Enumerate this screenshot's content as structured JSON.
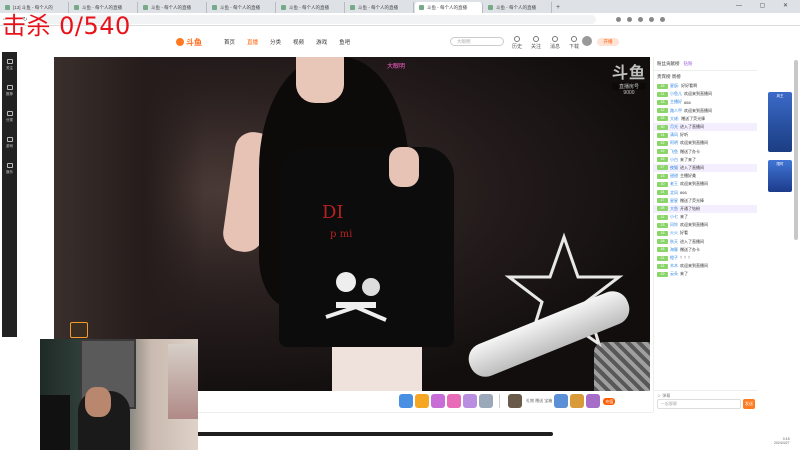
{
  "overlay": {
    "kill_counter": "击杀 0/540"
  },
  "browser": {
    "tabs": [
      {
        "label": "[13] 斗鱼 - 每个人的"
      },
      {
        "label": "斗鱼 - 每个人的直播"
      },
      {
        "label": "斗鱼 - 每个人的直播"
      },
      {
        "label": "斗鱼 - 每个人的直播"
      },
      {
        "label": "斗鱼 - 每个人的直播"
      },
      {
        "label": "斗鱼 - 每个人的直播"
      },
      {
        "label": "斗鱼 - 每个人的直播"
      },
      {
        "label": "斗鱼 - 每个人的直播"
      }
    ],
    "new_tab": "+",
    "window_controls": "— ▢ ✕"
  },
  "site": {
    "nav": [
      "首页",
      "直播",
      "分类",
      "视频",
      "游戏",
      "鱼吧"
    ],
    "search_placeholder": "大眼明",
    "header_icons": [
      "历史",
      "关注",
      "消息",
      "下载"
    ],
    "open_live": "开播"
  },
  "sidebar": {
    "items": [
      "关注",
      "推荐",
      "分类",
      "游戏",
      "娱乐"
    ]
  },
  "video": {
    "username_tag": "大眼明",
    "watermark_logo": "斗鱼",
    "watermark_sub": "直播房号",
    "watermark_id": "9000",
    "shirt_text_1": "DI",
    "shirt_text_2": "p mi"
  },
  "gifts": {
    "text": "礼物 赠送 宝箱",
    "button": "充值"
  },
  "chat": {
    "tabs": [
      "粉丝贡献榜",
      "钻粉"
    ],
    "rank_row": "贵宾榜 周榜",
    "messages": [
      {
        "level": "15",
        "user": "星辰:",
        "msg": "好好看啊"
      },
      {
        "level": "21",
        "user": "小鱼儿",
        "msg": "欢迎来到直播间"
      },
      {
        "level": "18",
        "user": "主播好",
        "msg": "666"
      },
      {
        "level": "12",
        "user": "路人甲",
        "msg": "欢迎来到直播间"
      },
      {
        "level": "25",
        "user": "大佬:",
        "msg": "赠送了荧光棒"
      },
      {
        "level": "30",
        "user": "月光",
        "msg": "进入了直播间",
        "hl": true
      },
      {
        "level": "14",
        "user": "清风",
        "msg": "好听"
      },
      {
        "level": "22",
        "user": "阿明",
        "msg": "欢迎来到直播间"
      },
      {
        "level": "19",
        "user": "飞鱼",
        "msg": "赠送了办卡"
      },
      {
        "level": "16",
        "user": "小白",
        "msg": "来了来了"
      },
      {
        "level": "27",
        "user": "夜猫",
        "msg": "进入了直播间",
        "hl": true
      },
      {
        "level": "13",
        "user": "甜甜",
        "msg": "主播好美"
      },
      {
        "level": "20",
        "user": "老王",
        "msg": "欢迎来到直播间"
      },
      {
        "level": "24",
        "user": "北风",
        "msg": "666"
      },
      {
        "level": "17",
        "user": "星星",
        "msg": "赠送了荧光棒"
      },
      {
        "level": "28",
        "user": "大鱼",
        "msg": "开通了钻粉",
        "hl": true
      },
      {
        "level": "11",
        "user": "小七",
        "msg": "来了"
      },
      {
        "level": "23",
        "user": "风铃",
        "msg": "欢迎来到直播间"
      },
      {
        "level": "15",
        "user": "火火",
        "msg": "好看"
      },
      {
        "level": "26",
        "user": "秋天",
        "msg": "进入了直播间"
      },
      {
        "level": "18",
        "user": "海豚",
        "msg": "赠送了办卡"
      },
      {
        "level": "21",
        "user": "橙子",
        "msg": "！！！"
      },
      {
        "level": "14",
        "user": "木木",
        "msg": "欢迎来到直播间"
      },
      {
        "level": "29",
        "user": "云朵",
        "msg": "来了"
      }
    ],
    "input_placeholder": "一起聊聊",
    "send": "发送",
    "tools": "☺ 弹幕"
  },
  "ads": {
    "ad1": "风王",
    "ad2": "限时"
  },
  "clock": {
    "time": "0:18",
    "date": "2024/4/27"
  }
}
